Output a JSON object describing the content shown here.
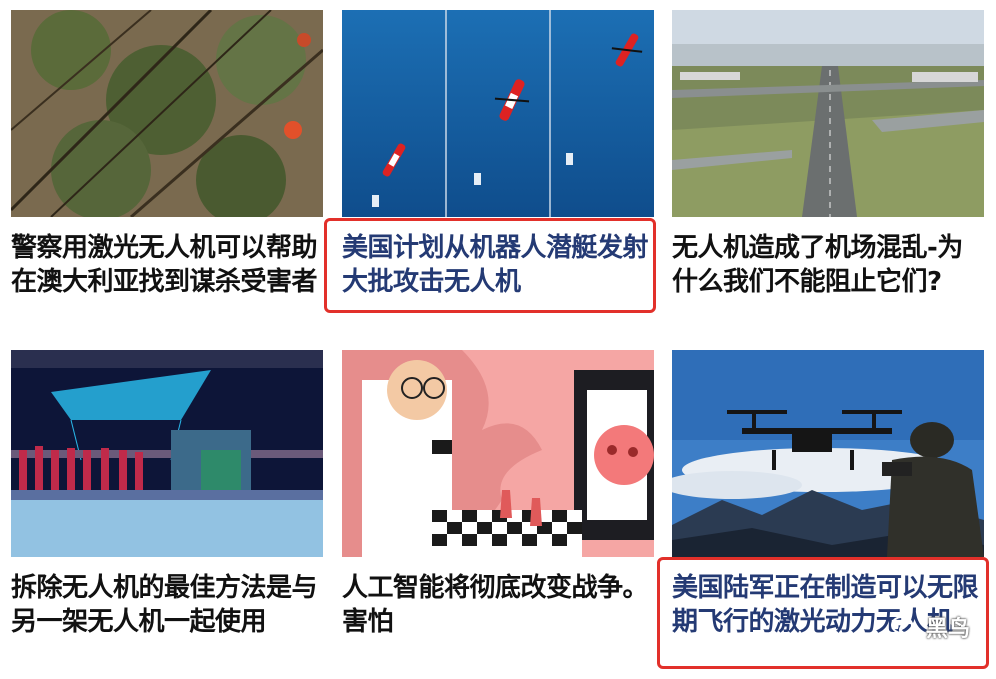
{
  "articles": [
    {
      "title": "警察用激光无人机可以帮助在澳大利亚找到谋杀受害者",
      "highlighted": false,
      "image": "aerial-forest-search-drone-photo"
    },
    {
      "title": "美国计划从机器人潜艇发射大批攻击无人机",
      "highlighted": true,
      "image": "drone-launch-sequence-photo"
    },
    {
      "title": "无人机造成了机场混乱-为什么我们不能阻止它们?",
      "highlighted": false,
      "image": "airport-runway-aerial-photo"
    },
    {
      "title": "拆除无人机的最佳方法是与另一架无人机一起使用",
      "highlighted": false,
      "image": "stage-drone-show-photo"
    },
    {
      "title": "人工智能将彻底改变战争。害怕",
      "highlighted": false,
      "image": "ai-chess-illustration"
    },
    {
      "title": "美国陆军正在制造可以无限期飞行的激光动力无人机",
      "highlighted": true,
      "image": "soldier-drone-mountains-photo"
    }
  ],
  "watermark": {
    "text": "黑鸟",
    "icon": "wechat-icon"
  },
  "colors": {
    "highlight": "#e2302a",
    "title_highlighted": "#243a74",
    "title": "#111111"
  }
}
